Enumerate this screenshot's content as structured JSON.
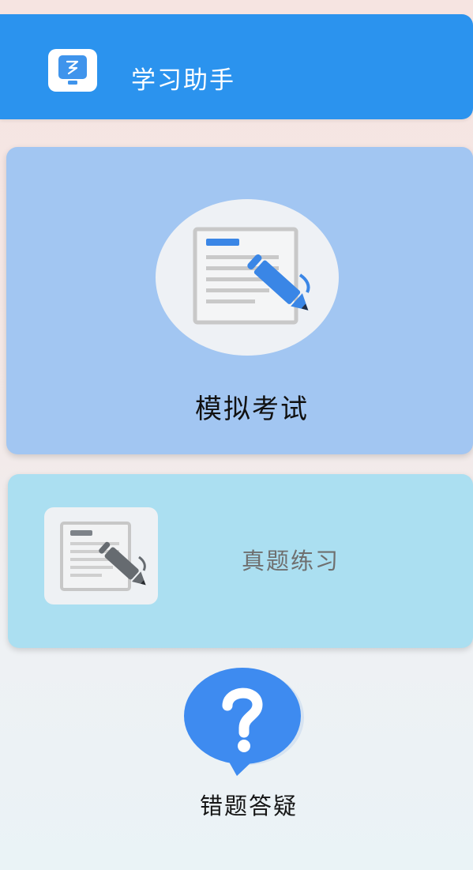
{
  "header": {
    "title": "学习助手",
    "icon": "monitor-icon",
    "color": "#2b93ee"
  },
  "cards": {
    "exam": {
      "label": "模拟考试",
      "icon": "document-pencil-icon",
      "color": "#a2c6f2"
    },
    "practice": {
      "label": "真题练习",
      "icon": "document-pencil-icon",
      "color": "#abdff1"
    },
    "wrong_qa": {
      "label": "错题答疑",
      "icon": "question-bubble-icon",
      "color": "#3e8bf0"
    }
  }
}
